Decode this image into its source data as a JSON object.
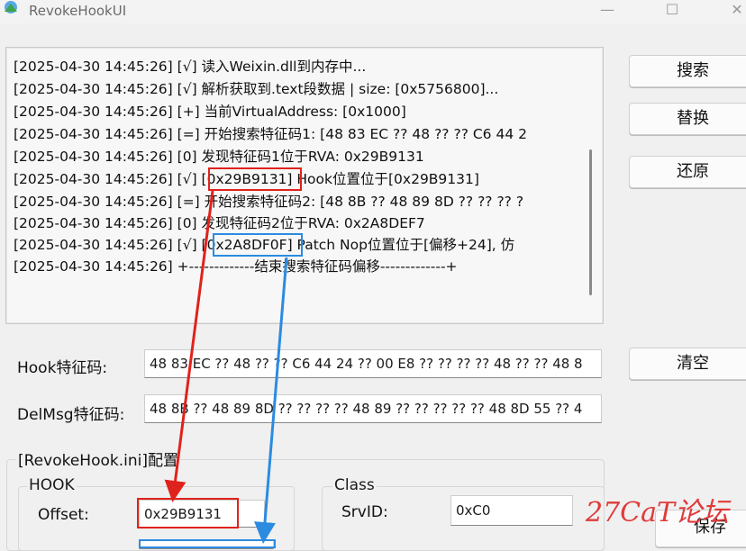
{
  "window": {
    "title": "RevokeHookUI",
    "minimize": "—",
    "maximize": "☐",
    "close": "✕"
  },
  "log": {
    "lines": [
      "[2025-04-30 14:45:26] [√] 读入Weixin.dll到内存中...",
      "[2025-04-30 14:45:26] [√] 解析获取到.text段数据 | size: [0x5756800]...",
      "[2025-04-30 14:45:26] [+] 当前VirtualAddress: [0x1000]",
      "[2025-04-30 14:45:26] [=] 开始搜索特征码1: [48 83 EC ?? 48 ?? ?? C6 44 2",
      "[2025-04-30 14:45:26] [0] 发现特征码1位于RVA: 0x29B9131",
      "[2025-04-30 14:45:26] [√] [0x29B9131] Hook位置位于[0x29B9131]",
      "[2025-04-30 14:45:26] [=] 开始搜索特征码2: [48 8B ?? 48 89 8D ?? ?? ?? ?",
      "[2025-04-30 14:45:26] [0] 发现特征码2位于RVA: 0x2A8DEF7",
      "[2025-04-30 14:45:26] [√] [0x2A8DF0F] Patch Nop位置位于[偏移+24], 仿",
      "[2025-04-30 14:45:26] +-------------结束搜索特征码偏移-------------+"
    ]
  },
  "buttons": {
    "search": "搜索",
    "replace": "替换",
    "restore": "还原",
    "clear": "清空",
    "save": "保存"
  },
  "hook_sig": {
    "label": "Hook特征码:",
    "value": "48 83 EC ?? 48 ?? ?? C6 44 24 ?? 00 E8 ?? ?? ?? ?? 48 ?? ?? 48 8"
  },
  "delmsg_sig": {
    "label": "DelMsg特征码:",
    "value": "48 8B ?? 48 89 8D ?? ?? ?? ?? 48 89 ?? ?? ?? ?? ?? 48 8D 55 ?? 4"
  },
  "config": {
    "title": "[RevokeHook.ini]配置",
    "hook_group": {
      "title": "HOOK",
      "offset_label": "Offset:",
      "offset_value": "0x29B9131"
    },
    "class_group": {
      "title": "Class",
      "srvid_label": "SrvID:",
      "srvid_value": "0xC0"
    }
  },
  "watermark": "27CaT论坛",
  "colors": {
    "annotation_red": "#e0221c",
    "annotation_blue": "#2b8be0",
    "watermark": "#e03a3a"
  }
}
